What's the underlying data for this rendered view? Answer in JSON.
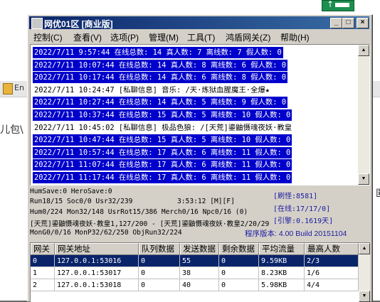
{
  "background": {
    "strip_text": "En",
    "side_text": "儿包\\",
    "right_text": "匿"
  },
  "window": {
    "title": "网优01区 [商业版]",
    "controls": {
      "minimize": "_",
      "maximize": "□",
      "close": "×"
    }
  },
  "menu": [
    {
      "label": "控制(C)"
    },
    {
      "label": "查看(V)"
    },
    {
      "label": "选项(P)"
    },
    {
      "label": "管理(M)"
    },
    {
      "label": "工具(T)"
    },
    {
      "label": "鸿盾网关(Z)"
    },
    {
      "label": "帮助(H)"
    }
  ],
  "log": [
    {
      "text": "2022/7/11 9:57:44 在线总数: 14 真人数: 7 离线数: 7 假人数: 0",
      "selected": true
    },
    {
      "text": "2022/7/11 10:07:44 在线总数: 14 真人数: 8 离线数: 6 假人数: 0",
      "selected": true
    },
    {
      "text": "2022/7/11 10:17:44 在线总数: 14 真人数: 6 离线数: 8 假人数: 0",
      "selected": true
    },
    {
      "text": "2022/7/11 10:24:47 [私聊信息] 音乐: /天·炼狱血腥魔王·全爆★",
      "selected": false
    },
    {
      "text": "2022/7/11 10:27:44 在线总数: 14 真人数: 5 离线数: 9 假人数: 0",
      "selected": true
    },
    {
      "text": "2022/7/11 10:37:44 在线总数: 15 真人数: 5 离线数: 10 假人数: 0",
      "selected": true
    },
    {
      "text": "2022/7/11 10:45:02 [私聊信息] 极品色狼: /[天荒]鎏鼬慑魂夜妖·教皇",
      "selected": false
    },
    {
      "text": "2022/7/11 10:47:44 在线总数: 15 真人数: 5 离线数: 10 假人数: 0",
      "selected": true
    },
    {
      "text": "2022/7/11 10:57:44 在线总数: 17 真人数: 6 离线数: 11 假人数: 0",
      "selected": true
    },
    {
      "text": "2022/7/11 11:07:44 在线总数: 17 真人数: 6 离线数: 11 假人数: 0",
      "selected": true
    },
    {
      "text": "2022/7/11 11:17:44 在线总数: 17 真人数: 6 离线数: 11 假人数: 0",
      "selected": true
    }
  ],
  "scroll": {
    "up": "▲",
    "down": "▼"
  },
  "stats": {
    "l1": "HumSave:0 HeroSave:0",
    "l2": "Run18/15 Soc0/0 Usr32/239",
    "l2b": "3:53:12 [M][F]",
    "l3": "Hum0/224 Mon32/148 UsrRot15/386 Merch0/16 Npc0/16 (0)",
    "l4": "[天荒]鎏鼬慑魂夜妖·教皇1,127/200 - [天荒]鎏鼬慑魂夜妖·教皇2/20/29",
    "l5": "MonG0/0/16 MonP32/62/250 ObjRun32/224",
    "refresh": "[刷怪:8581]",
    "online": "[在线:17/17/0]",
    "lag": "[引擎:0.1619天]",
    "version": "程序版本: 4.00 Build 20151104"
  },
  "grid": {
    "columns": [
      "网关",
      "网关地址",
      "队列数据",
      "发送数据",
      "剩余数据",
      "平均流量",
      "最高人数"
    ],
    "rows": [
      {
        "cells": [
          "0",
          "127.0.0.1:53016",
          "0",
          "55",
          "0",
          "9.59KB",
          "2/3"
        ],
        "selected": true
      },
      {
        "cells": [
          "1",
          "127.0.0.1:53017",
          "0",
          "38",
          "0",
          "8.23KB",
          "1/6"
        ],
        "selected": false
      },
      {
        "cells": [
          "2",
          "127.0.0.1:53018",
          "0",
          "40",
          "0",
          "5.98KB",
          "4/4"
        ],
        "selected": false
      }
    ]
  }
}
